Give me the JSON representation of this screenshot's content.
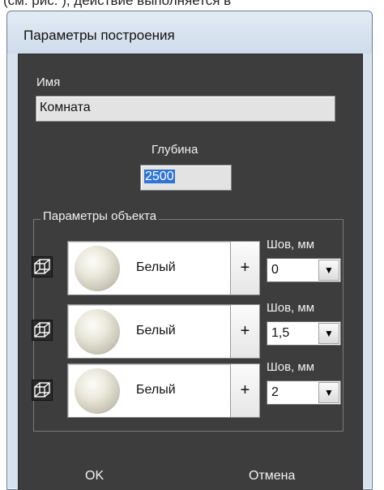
{
  "top_strip": {
    "text": "(см. рис. ), действие выполняется в"
  },
  "window": {
    "title": "Параметры построения"
  },
  "name_field": {
    "label": "Имя",
    "value": "Комната"
  },
  "depth_field": {
    "label": "Глубина",
    "value": "2500"
  },
  "object_params": {
    "legend": "Параметры объекта",
    "rows": [
      {
        "material": "Белый",
        "plus": "+",
        "seam_label": "Шов, мм",
        "seam_value": "0"
      },
      {
        "material": "Белый",
        "plus": "+",
        "seam_label": "Шов, мм",
        "seam_value": "1,5"
      },
      {
        "material": "Белый",
        "plus": "+",
        "seam_label": "Шов, мм",
        "seam_value": "2"
      }
    ]
  },
  "buttons": {
    "ok": "OK",
    "cancel": "Отмена"
  },
  "icons": {
    "cube": "cube-wireframe-icon",
    "dropdown": "chevron-down-icon"
  }
}
